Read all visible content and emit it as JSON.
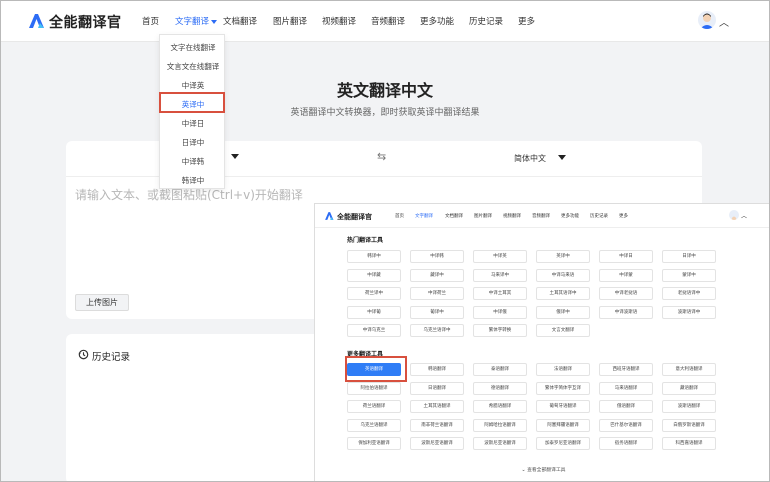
{
  "colors": {
    "accent": "#2c6cf5",
    "highlight": "#d8503e",
    "page_bg": "#f2f3f5"
  },
  "nav": {
    "brand": "全能翻译官",
    "items": [
      {
        "label": "首页"
      },
      {
        "label": "文字翻译"
      },
      {
        "label": "文档翻译"
      },
      {
        "label": "图片翻译"
      },
      {
        "label": "视频翻译"
      },
      {
        "label": "音频翻译"
      },
      {
        "label": "更多功能"
      },
      {
        "label": "历史记录"
      },
      {
        "label": "更多"
      }
    ],
    "active_index": 1
  },
  "dropdown": {
    "items": [
      {
        "label": "文字在线翻译"
      },
      {
        "label": "文言文在线翻译"
      },
      {
        "label": "中译英"
      },
      {
        "label": "英译中"
      },
      {
        "label": "中译日"
      },
      {
        "label": "日译中"
      },
      {
        "label": "中译韩"
      },
      {
        "label": "韩译中"
      }
    ],
    "selected_index": 3
  },
  "hero": {
    "title": "英文翻译中文",
    "subtitle": "英语翻译中文转换器，即时获取英译中翻译结果"
  },
  "translator": {
    "target_lang": "简体中文",
    "input_placeholder": "请输入文本、或截图粘贴(Ctrl+v)开始翻译",
    "upload_label": "上传图片"
  },
  "history": {
    "title": "历史记录"
  },
  "overlay": {
    "brand": "全能翻译官",
    "nav_items": [
      {
        "label": "首页"
      },
      {
        "label": "文字翻译"
      },
      {
        "label": "文档翻译"
      },
      {
        "label": "图片翻译"
      },
      {
        "label": "视频翻译"
      },
      {
        "label": "音频翻译"
      },
      {
        "label": "更多功能"
      },
      {
        "label": "历史记录"
      },
      {
        "label": "更多"
      }
    ],
    "hot_title": "热门翻译工具",
    "hot_tools": [
      [
        "韩译中",
        "中译韩",
        "中译英",
        "英译中",
        "中译日",
        "日译中"
      ],
      [
        "中译藏",
        "藏译中",
        "马来译中",
        "中译马来语",
        "中译蒙",
        "蒙译中"
      ],
      [
        "荷兰译中",
        "中译荷兰",
        "中译土耳其",
        "土耳其语译中",
        "中译老挝语",
        "老挝语译中"
      ],
      [
        "中译葡",
        "葡译中",
        "中译俄",
        "俄译中",
        "中译波斯语",
        "波斯语译中"
      ],
      [
        "中译乌克兰",
        "乌克兰语译中",
        "繁体字转换",
        "文言文翻译"
      ]
    ],
    "more_title": "更多翻译工具",
    "more_tools": [
      [
        "英语翻译",
        "韩语翻译",
        "泰语翻译",
        "法语翻译",
        "西班牙语翻译",
        "意大利语翻译"
      ],
      [
        "阿拉伯语翻译",
        "日语翻译",
        "德语翻译",
        "繁体字简体字互译",
        "马来语翻译",
        "藏语翻译"
      ],
      [
        "荷兰语翻译",
        "土耳其语翻译",
        "希腊语翻译",
        "葡萄牙语翻译",
        "俄语翻译",
        "波斯语翻译"
      ],
      [
        "乌克兰语翻译",
        "南非荷兰语翻译",
        "阿姆哈拉语翻译",
        "阿塞拜疆语翻译",
        "巴什基尔语翻译",
        "白俄罗斯语翻译"
      ],
      [
        "保加利亚语翻译",
        "波斯尼亚语翻译",
        "波斯尼亚语翻译",
        "加泰罗尼亚语翻译",
        "宿务语翻译",
        "科西嘉语翻译"
      ]
    ],
    "view_all": "查看全部翻译工具"
  }
}
